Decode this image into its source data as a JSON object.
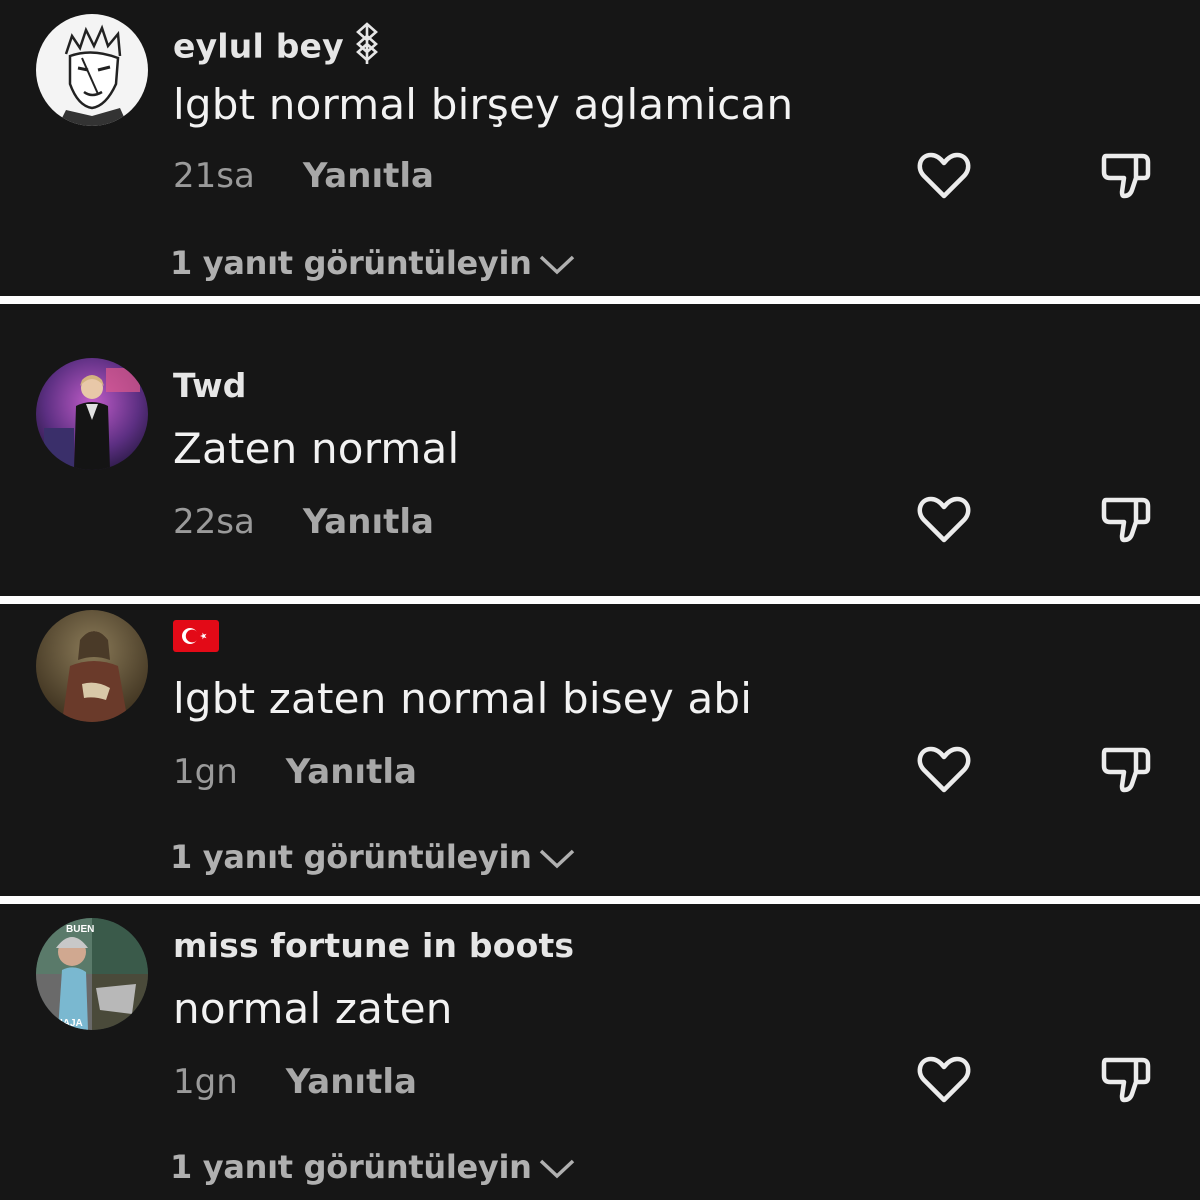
{
  "comments": [
    {
      "username": "eylul bey",
      "username_icon": "berserk-brand-icon",
      "text": "lgbt normal birşey aglamican",
      "time": "21sa",
      "reply_label": "Yanıtla",
      "view_replies": "1 yanıt görüntüleyin",
      "avatar": "anime-character-sketch"
    },
    {
      "username": "Twd",
      "text": "Zaten normal",
      "time": "22sa",
      "reply_label": "Yanıtla",
      "avatar": "person-photo-purple-background"
    },
    {
      "username": "🇹🇷",
      "username_icon": "turkey-flag-icon",
      "text": "lgbt zaten normal bisey abi",
      "time": "1gn",
      "reply_label": "Yanıtla",
      "view_replies": "1 yanıt görüntüleyin",
      "avatar": "classical-portrait-painting"
    },
    {
      "username": "miss fortune in boots",
      "text": "normal zaten",
      "time": "1gn",
      "reply_label": "Yanıtla",
      "view_replies": "1 yanıt görüntüleyin",
      "avatar": "comic-collage",
      "avatar_text_top": "BUEN",
      "avatar_text_bottom": "IAJA"
    }
  ],
  "icons": {
    "like": "heart-outline-icon",
    "dislike": "thumbs-down-outline-icon",
    "expand": "chevron-down-icon"
  },
  "colors": {
    "background": "#161616",
    "separator": "#ffffff",
    "text_primary": "#f2f2f2",
    "text_secondary": "#9a9a9a",
    "turkey_flag_red": "#e30a17"
  }
}
